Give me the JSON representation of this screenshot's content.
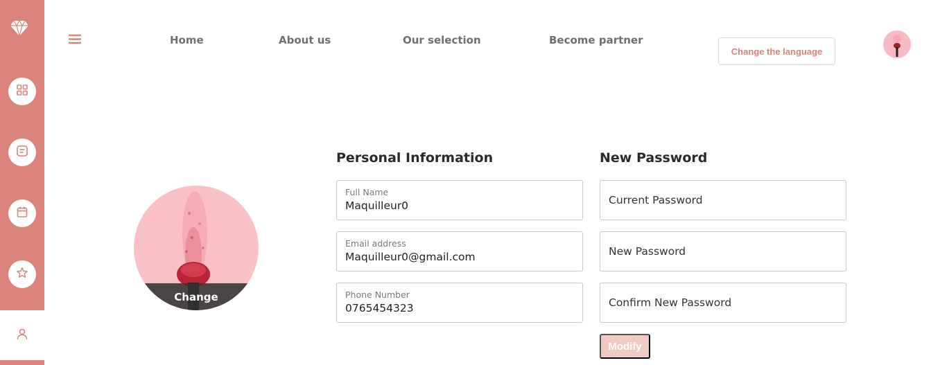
{
  "colors": {
    "accent": "#d9837a",
    "accent_light": "#f1c9c5",
    "text_dark": "#2a2a2a",
    "nav_text": "#6f6f6f"
  },
  "sidebar": {
    "logo_icon": "diamond-icon",
    "items": [
      {
        "icon": "grid-icon",
        "active": false
      },
      {
        "icon": "note-icon",
        "active": false
      },
      {
        "icon": "calendar-icon",
        "active": false
      },
      {
        "icon": "star-icon",
        "active": false
      },
      {
        "icon": "user-icon",
        "active": true
      }
    ]
  },
  "header": {
    "menu_icon": "hamburger-icon",
    "nav": [
      {
        "label": "Home"
      },
      {
        "label": "About us"
      },
      {
        "label": "Our selection"
      },
      {
        "label": "Become partner"
      }
    ],
    "language_button": "Change the language"
  },
  "profile": {
    "change_label": "Change"
  },
  "personal_info": {
    "title": "Personal Information",
    "fields": [
      {
        "label": "Full Name",
        "value": "Maquilleur0"
      },
      {
        "label": "Email address",
        "value": "Maquilleur0@gmail.com"
      },
      {
        "label": "Phone Number",
        "value": "0765454323"
      }
    ]
  },
  "new_password": {
    "title": "New Password",
    "fields": [
      {
        "placeholder": "Current Password"
      },
      {
        "placeholder": "New Password"
      },
      {
        "placeholder": "Confirm New Password"
      }
    ],
    "submit_label": "Modify"
  }
}
